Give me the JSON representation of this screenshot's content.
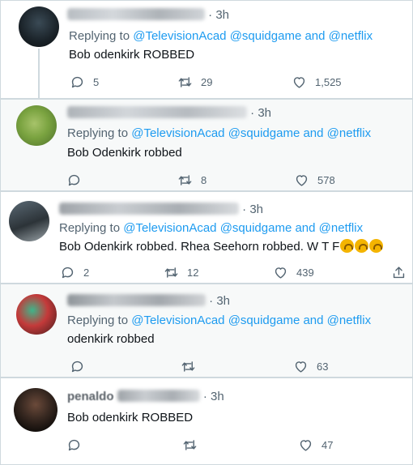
{
  "tweets": [
    {
      "time": "3h",
      "replying_prefix": "Replying to",
      "mentions": [
        "@TelevisionAcad",
        "@squidgame",
        "and",
        "@netflix"
      ],
      "text": "Bob odenkirk ROBBED",
      "replies": "5",
      "retweets": "29",
      "likes": "1,525"
    },
    {
      "time": "3h",
      "replying_prefix": "Replying to",
      "mentions": [
        "@TelevisionAcad",
        "@squidgame",
        "and",
        "@netflix"
      ],
      "text": "Bob Odenkirk robbed",
      "replies": "",
      "retweets": "8",
      "likes": "578"
    },
    {
      "time": "3h",
      "replying_prefix": "Replying to",
      "mentions": [
        "@TelevisionAcad",
        "@squidgame",
        "and",
        "@netflix"
      ],
      "text": "Bob Odenkirk robbed. Rhea Seehorn robbed. W T F",
      "replies": "2",
      "retweets": "12",
      "likes": "439"
    },
    {
      "time": "3h",
      "replying_prefix": "Replying to",
      "mentions": [
        "@TelevisionAcad",
        "@squidgame",
        "and",
        "@netflix"
      ],
      "text": "odenkirk robbed",
      "replies": "",
      "retweets": "",
      "likes": "63"
    },
    {
      "name": "penaldo",
      "time": "3h",
      "text": "Bob odenkirk ROBBED",
      "replies": "",
      "retweets": "",
      "likes": "47"
    }
  ],
  "colors": {
    "accent": "#1d9bf0",
    "muted": "#536471",
    "border": "#cfd9de",
    "text": "#0f1419"
  }
}
